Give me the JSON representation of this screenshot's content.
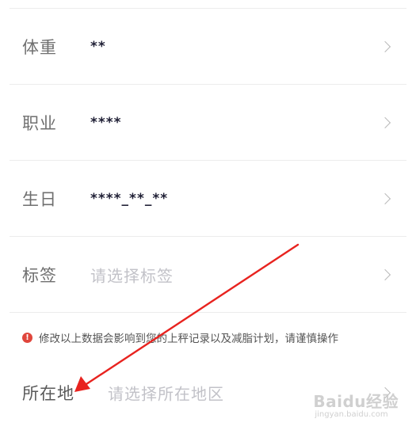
{
  "form": {
    "rows": [
      {
        "label": "体重",
        "value": "**",
        "placeholder": false
      },
      {
        "label": "职业",
        "value": "****",
        "placeholder": false
      },
      {
        "label": "生日",
        "value": "****_**_**",
        "placeholder": false
      },
      {
        "label": "标签",
        "value": "请选择标签",
        "placeholder": true
      }
    ],
    "warning": {
      "icon": "!",
      "text": "修改以上数据会影响到您的上秤记录以及减脂计划，请谨慎操作"
    },
    "location": {
      "label": "所在地",
      "placeholder": "请选择所在地区"
    }
  },
  "annotation": {
    "arrow_color": "#e8231f"
  },
  "watermark": {
    "main": "Baidu经验",
    "sub": "jingyan.baidu.com"
  }
}
